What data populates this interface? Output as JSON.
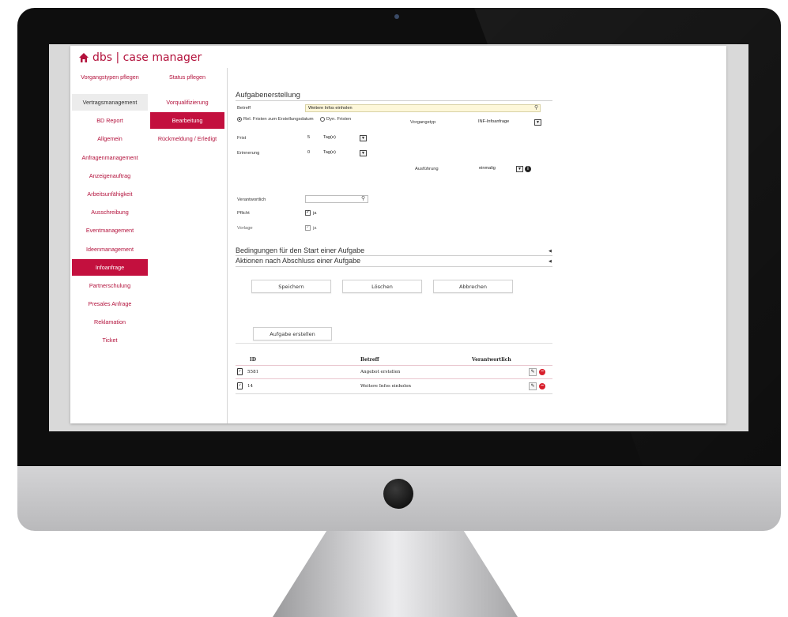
{
  "app": {
    "title": "dbs | case manager",
    "home_icon": "home-icon",
    "accent": "#c3103e"
  },
  "nav_col1": {
    "header": "Vorgangstypen pflegen",
    "items": [
      "Vertragsmanagement",
      "BD Report",
      "Allgemein",
      "Anfragenmanagement",
      "Anzeigenauftrag",
      "Arbeitsunfähigkeit",
      "Ausschreibung",
      "Eventmanagement",
      "Ideenmanagement",
      "Infoanfrage",
      "Partnerschulung",
      "Presales Anfrage",
      "Reklamation",
      "Ticket"
    ],
    "selected": "Vertragsmanagement",
    "active": "Infoanfrage"
  },
  "nav_col2": {
    "header": "Status pflegen",
    "items": [
      "Vorqualifizierung",
      "Bearbeitung",
      "Rückmeldung / Erledigt"
    ],
    "active": "Bearbeitung"
  },
  "form": {
    "title": "Aufgabenerstellung",
    "betreff_label": "Betreff",
    "betreff_value": "Weitere Infos einholen",
    "radio_rel_label": "Rel. Fristen zum Erstellungsdatum",
    "radio_dyn_label": "Dyn. Fristen",
    "vorgangstyp_label": "Vorgangstyp",
    "vorgangstyp_value": "INF-Infoanfrage",
    "frist_label": "Frist",
    "frist_value": "5",
    "frist_unit": "Tag(e)",
    "erinnerung_label": "Erinnerung",
    "erinnerung_value": "0",
    "erinnerung_unit": "Tag(e)",
    "ausfuehrung_label": "Ausführung",
    "ausfuehrung_value": "einmalig",
    "verantwortlich_label": "Verantwortlich",
    "verantwortlich_value": "",
    "pflicht_label": "Pflicht",
    "pflicht_checkbox_label": "ja",
    "vorlage_label": "Vorlage",
    "vorlage_checkbox_label": "ja"
  },
  "accordions": {
    "start": "Bedingungen für den Start einer Aufgabe",
    "end": "Aktionen nach Abschluss einer Aufgabe"
  },
  "buttons": {
    "save": "Speichern",
    "delete": "Löschen",
    "cancel": "Abbrechen",
    "create_task": "Aufgabe erstellen"
  },
  "table": {
    "headers": {
      "id": "ID",
      "betreff": "Betreff",
      "verantwortlich": "Verantwortlich"
    },
    "rows": [
      {
        "id": "5581",
        "betreff": "Angebot erstellen",
        "verantwortlich": ""
      },
      {
        "id": "14",
        "betreff": "Weitere Infos einholen",
        "verantwortlich": ""
      }
    ]
  }
}
